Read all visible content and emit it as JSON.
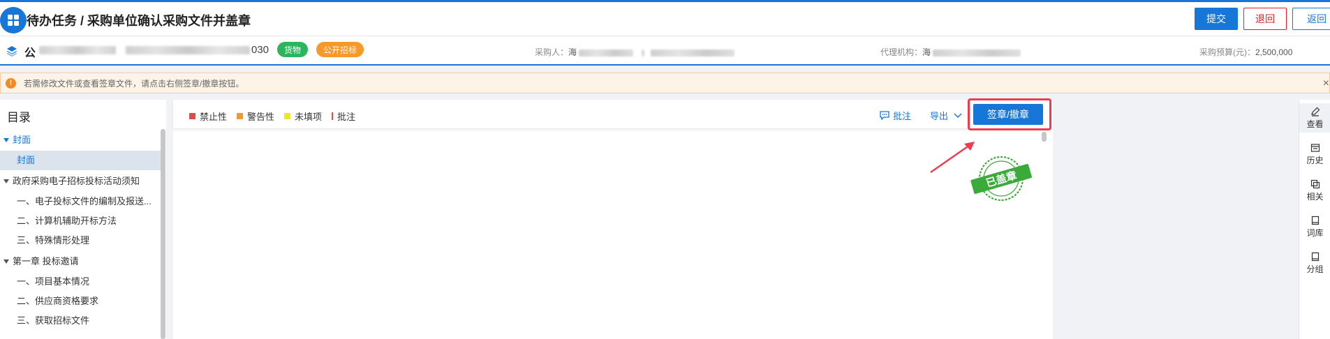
{
  "header": {
    "title": "待办任务 / 采购单位确认采购文件并盖章",
    "submit_label": "提交",
    "reject_label": "退回",
    "back_label": "返回"
  },
  "project": {
    "name_prefix": "公",
    "code_suffix": "030",
    "tags": [
      "货物",
      "公开招标"
    ],
    "purchaser_label": "采购人：",
    "purchaser_value": "海",
    "agency_label": "代理机构：",
    "agency_value": "海",
    "budget_label": "采购预算(元)：",
    "budget_value": "2,500,000"
  },
  "notice": {
    "icon": "!",
    "text": "若需修改文件或查看签章文件，请点击右侧签章/撤章按钮。",
    "close": "×"
  },
  "toc": {
    "title": "目录",
    "items": [
      {
        "label": "封面",
        "level": "section",
        "expanded": true,
        "highlight": true
      },
      {
        "label": "封面",
        "level": "sub",
        "active": true
      },
      {
        "label": "政府采购电子招标投标活动须知",
        "level": "section",
        "expanded": true
      },
      {
        "label": "一、电子投标文件的编制及报送...",
        "level": "sub"
      },
      {
        "label": "二、计算机辅助开标方法",
        "level": "sub"
      },
      {
        "label": "三、特殊情形处理",
        "level": "sub"
      },
      {
        "label": "第一章 投标邀请",
        "level": "section",
        "expanded": true
      },
      {
        "label": "一、项目基本情况",
        "level": "sub"
      },
      {
        "label": "二、供应商资格要求",
        "level": "sub"
      },
      {
        "label": "三、获取招标文件",
        "level": "sub"
      }
    ]
  },
  "toolbar": {
    "legend": [
      {
        "label": "禁止性",
        "color": "#e24b4b"
      },
      {
        "label": "警告性",
        "color": "#f6992a"
      },
      {
        "label": "未填项",
        "color": "#f5e61a"
      },
      {
        "label": "批注",
        "color": "#e24b4b"
      }
    ],
    "annotate_label": "批注",
    "export_label": "导出",
    "sign_label": "签章/撤章"
  },
  "stamp": {
    "text": "已盖章",
    "color": "#3aab3a"
  },
  "rightbar": {
    "items": [
      "查看",
      "历史",
      "相关",
      "词库",
      "分组"
    ]
  }
}
